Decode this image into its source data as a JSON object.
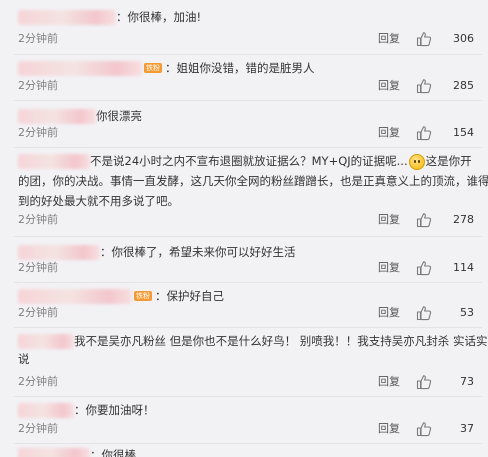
{
  "comments": [
    {
      "text": "：你很棒，加油!",
      "time": "2分钟前",
      "reply": "回复",
      "likes": "306"
    },
    {
      "text": "：姐姐你没错，错的是脏男人",
      "time": "2分钟前",
      "reply": "回复",
      "likes": "285",
      "badge": "铁粉"
    },
    {
      "text": "你很漂亮",
      "time": "2分钟前",
      "reply": "回复",
      "likes": "154"
    },
    {
      "line1_a": "不是说24小时之内不宣布退圈就放证据么？MY+QJ的证据呢...",
      "line1_b": "这是你开",
      "line2": "的团，你的决战。事情一直发酵，这几天你全网的粉丝蹭蹭长，也是正真意义上的顶流，谁得",
      "line3": "到的好处最大就不用多说了吧。",
      "time": "2分钟前",
      "reply": "回复",
      "likes": "278"
    },
    {
      "text": "：你很棒了，希望未来你可以好好生活",
      "time": "2分钟前",
      "reply": "回复",
      "likes": "114"
    },
    {
      "text": "：保护好自己",
      "time": "2分钟前",
      "reply": "回复",
      "likes": "53",
      "badge": "铁粉"
    },
    {
      "line1": "我不是吴亦凡粉丝 但是你也不是什么好鸟！ 别喷我！！我支持吴亦凡封杀 实话实",
      "line2": "说",
      "time": "2分钟前",
      "reply": "回复",
      "likes": "73"
    },
    {
      "text": "：你要加油呀！",
      "time": "2分钟前",
      "reply": "回复",
      "likes": "37"
    },
    {
      "text": "：你很棒"
    }
  ]
}
